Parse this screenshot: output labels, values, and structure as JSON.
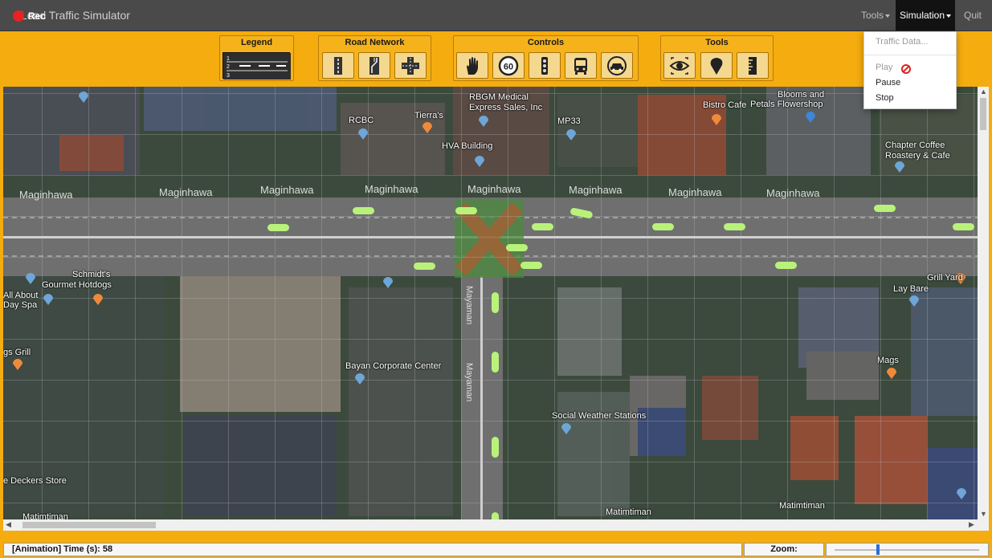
{
  "app": {
    "title": "Load Traffic Simulator",
    "rec_label": "Rec"
  },
  "menu": {
    "tools": "Tools",
    "simulation": "Simulation",
    "quit": "Quit"
  },
  "dropdown": {
    "traffic_data": "Traffic Data...",
    "play": "Play",
    "pause": "Pause",
    "stop": "Stop"
  },
  "toolbar": {
    "legend": {
      "title": "Legend",
      "lanes": [
        "1",
        "2",
        "3"
      ]
    },
    "road_network": {
      "title": "Road Network",
      "buttons": [
        "straight-road-icon",
        "lane-merge-icon",
        "intersection-icon"
      ]
    },
    "controls": {
      "title": "Controls",
      "speed_limit": "60",
      "buttons": [
        "stop-hand-icon",
        "speed-limit-icon",
        "traffic-light-icon",
        "bus-icon",
        "car-icon"
      ]
    },
    "tools": {
      "title": "Tools",
      "buttons": [
        "eye-icon",
        "location-pin-icon",
        "ruler-icon"
      ]
    }
  },
  "map": {
    "places": [
      "RBGM Medical",
      "Express Sales, Inc",
      "Tierra's",
      "RCBC",
      "MP33",
      "HVA Building",
      "Bistro Cafe",
      "Blooms and",
      "Petals Flowershop",
      "Chapter Coffee",
      "Roastery & Cafe",
      "Schmidt's",
      "Gourmet Hotdogs",
      "All About",
      "Day Spa",
      "Grill Yard",
      "Lay Bare",
      "gs Grill",
      "Bayan Corporate Center",
      "Social Weather Stations",
      "Mags",
      "e Deckers Store",
      "Matimtiman"
    ],
    "road_name": "Maginhawa",
    "cross_road_name": "Mayaman"
  },
  "status": {
    "time_text": "[Animation] Time (s): 58",
    "zoom_label": "Zoom:",
    "zoom_level": 0.3
  },
  "colors": {
    "toolbar_bg": "#f4ac0e",
    "topbar_bg": "#4a4a4a",
    "car": "#b7f07a",
    "road": "#6e6e6e"
  }
}
